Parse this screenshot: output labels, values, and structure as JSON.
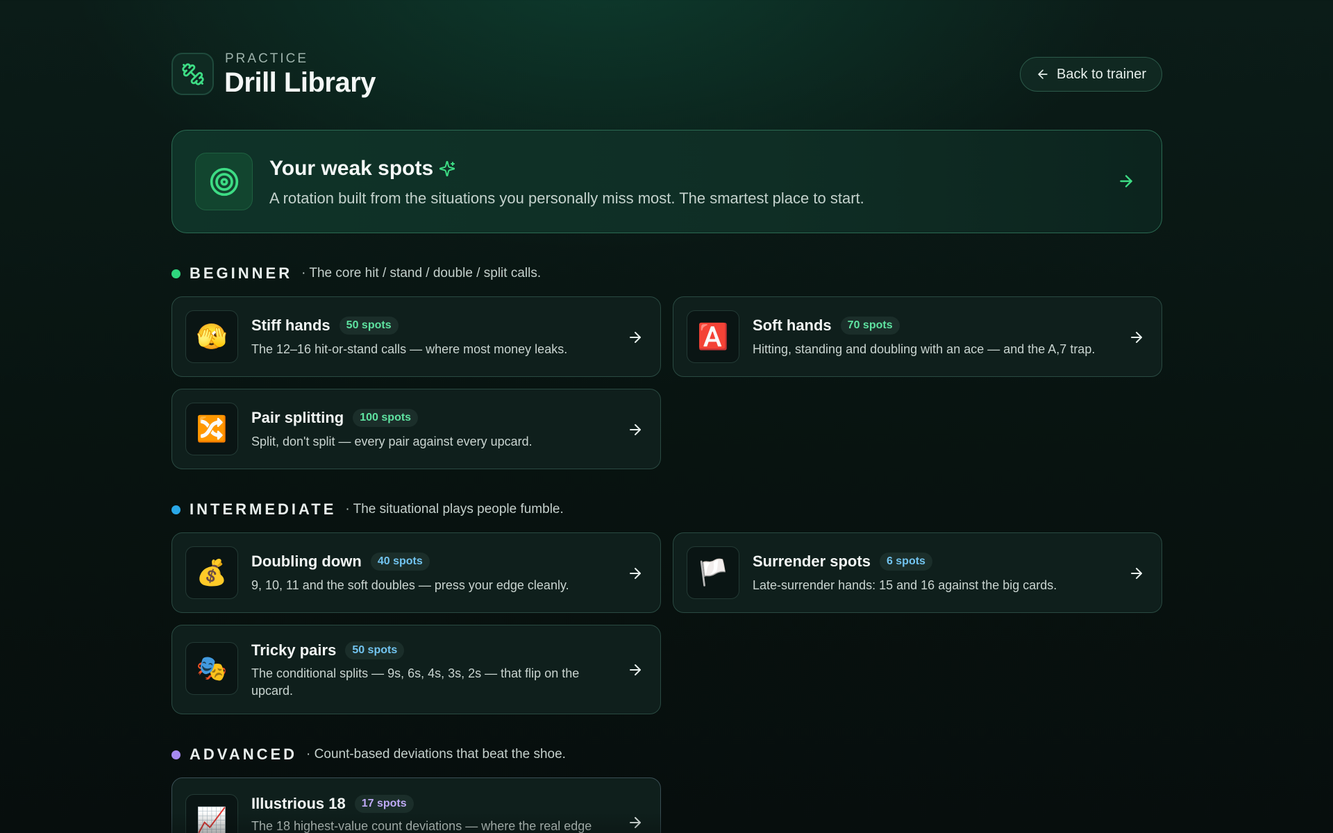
{
  "header": {
    "eyebrow": "PRACTICE",
    "title": "Drill Library",
    "logo_icon": "dumbbell-icon",
    "back_button": "Back to trainer"
  },
  "weak_spots": {
    "title": "Your weak spots",
    "description": "A rotation built from the situations you personally miss most. The smartest place to start.",
    "icon": "target-icon",
    "sparkle_icon": "sparkles-icon",
    "accent": "#3ddc84"
  },
  "sections": [
    {
      "level": "BEGINNER",
      "description": "· The core hit / stand / double / split calls.",
      "dot_color": "#2fd67e",
      "badge_color": "#5ee2a0",
      "drills": [
        {
          "emoji": "🫣",
          "title": "Stiff hands",
          "spots": "50 spots",
          "description": "The 12–16 hit-or-stand calls — where most money leaks."
        },
        {
          "emoji": "🅰️",
          "title": "Soft hands",
          "spots": "70 spots",
          "description": "Hitting, standing and doubling with an ace — and the A,7 trap."
        },
        {
          "emoji": "🔀",
          "title": "Pair splitting",
          "spots": "100 spots",
          "description": "Split, don't split — every pair against every upcard."
        }
      ]
    },
    {
      "level": "INTERMEDIATE",
      "description": "· The situational plays people fumble.",
      "dot_color": "#2aa8e8",
      "badge_color": "#72c4f0",
      "drills": [
        {
          "emoji": "💰",
          "title": "Doubling down",
          "spots": "40 spots",
          "description": "9, 10, 11 and the soft doubles — press your edge cleanly."
        },
        {
          "emoji": "🏳️",
          "title": "Surrender spots",
          "spots": "6 spots",
          "description": "Late-surrender hands: 15 and 16 against the big cards."
        },
        {
          "emoji": "🎭",
          "title": "Tricky pairs",
          "spots": "50 spots",
          "description": "The conditional splits — 9s, 6s, 4s, 3s, 2s — that flip on the upcard."
        }
      ]
    },
    {
      "level": "ADVANCED",
      "description": "· Count-based deviations that beat the shoe.",
      "dot_color": "#a68af0",
      "badge_color": "#bfaaf6",
      "drills": [
        {
          "emoji": "📈",
          "title": "Illustrious 18",
          "spots": "17 spots",
          "description": "The 18 highest-value count deviations — where the real edge"
        }
      ]
    }
  ]
}
